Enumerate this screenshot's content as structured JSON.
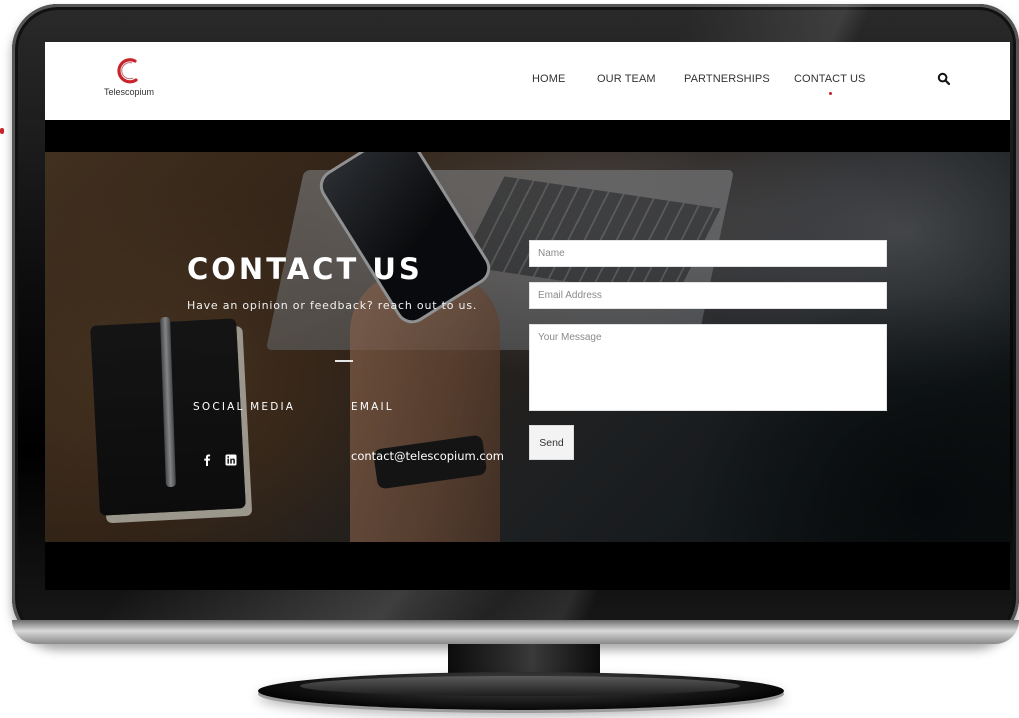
{
  "brand": {
    "name": "Telescopium",
    "accent_color": "#c9232b"
  },
  "nav": {
    "items": [
      {
        "label": "HOME",
        "active": false
      },
      {
        "label": "OUR TEAM",
        "active": false
      },
      {
        "label": "PARTNERSHIPS",
        "active": false
      },
      {
        "label": "CONTACT US",
        "active": true
      }
    ],
    "search_icon": "search-icon"
  },
  "hero": {
    "title": "CONTACT US",
    "subtitle": "Have an opinion or feedback? reach out to us.",
    "social_heading": "SOCIAL MEDIA",
    "email_heading": "EMAIL",
    "email": "contact@telescopium.com",
    "social_icons": [
      "facebook-icon",
      "linkedin-icon"
    ]
  },
  "form": {
    "name_placeholder": "Name",
    "email_placeholder": "Email Address",
    "message_placeholder": "Your Message",
    "submit_label": "Send"
  }
}
